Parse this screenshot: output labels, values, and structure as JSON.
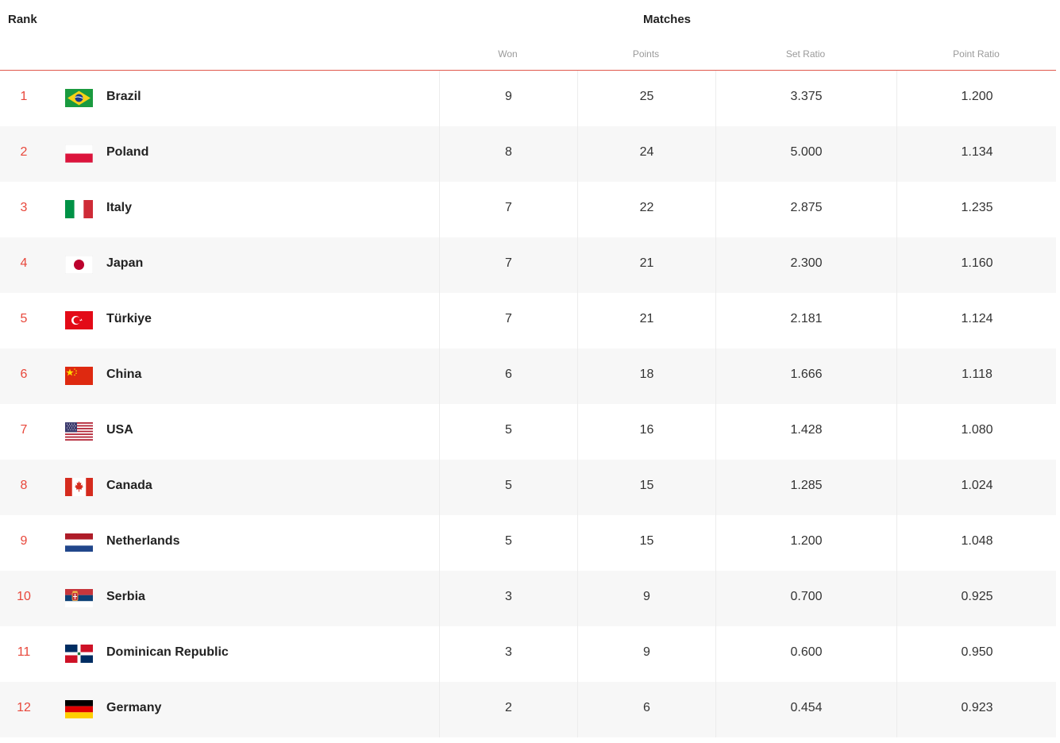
{
  "header": {
    "rank_label": "Rank",
    "matches_label": "Matches",
    "columns": {
      "won": "Won",
      "points": "Points",
      "set_ratio": "Set Ratio",
      "point_ratio": "Point Ratio"
    }
  },
  "rows": [
    {
      "rank": "1",
      "team": "Brazil",
      "flag": "brazil-flag-icon",
      "won": "9",
      "points": "25",
      "set_ratio": "3.375",
      "point_ratio": "1.200"
    },
    {
      "rank": "2",
      "team": "Poland",
      "flag": "poland-flag-icon",
      "won": "8",
      "points": "24",
      "set_ratio": "5.000",
      "point_ratio": "1.134"
    },
    {
      "rank": "3",
      "team": "Italy",
      "flag": "italy-flag-icon",
      "won": "7",
      "points": "22",
      "set_ratio": "2.875",
      "point_ratio": "1.235"
    },
    {
      "rank": "4",
      "team": "Japan",
      "flag": "japan-flag-icon",
      "won": "7",
      "points": "21",
      "set_ratio": "2.300",
      "point_ratio": "1.160"
    },
    {
      "rank": "5",
      "team": "Türkiye",
      "flag": "turkiye-flag-icon",
      "won": "7",
      "points": "21",
      "set_ratio": "2.181",
      "point_ratio": "1.124"
    },
    {
      "rank": "6",
      "team": "China",
      "flag": "china-flag-icon",
      "won": "6",
      "points": "18",
      "set_ratio": "1.666",
      "point_ratio": "1.118"
    },
    {
      "rank": "7",
      "team": "USA",
      "flag": "usa-flag-icon",
      "won": "5",
      "points": "16",
      "set_ratio": "1.428",
      "point_ratio": "1.080"
    },
    {
      "rank": "8",
      "team": "Canada",
      "flag": "canada-flag-icon",
      "won": "5",
      "points": "15",
      "set_ratio": "1.285",
      "point_ratio": "1.024"
    },
    {
      "rank": "9",
      "team": "Netherlands",
      "flag": "netherlands-flag-icon",
      "won": "5",
      "points": "15",
      "set_ratio": "1.200",
      "point_ratio": "1.048"
    },
    {
      "rank": "10",
      "team": "Serbia",
      "flag": "serbia-flag-icon",
      "won": "3",
      "points": "9",
      "set_ratio": "0.700",
      "point_ratio": "0.925"
    },
    {
      "rank": "11",
      "team": "Dominican Republic",
      "flag": "dominican-republic-flag-icon",
      "won": "3",
      "points": "9",
      "set_ratio": "0.600",
      "point_ratio": "0.950"
    },
    {
      "rank": "12",
      "team": "Germany",
      "flag": "germany-flag-icon",
      "won": "2",
      "points": "6",
      "set_ratio": "0.454",
      "point_ratio": "0.923"
    }
  ]
}
